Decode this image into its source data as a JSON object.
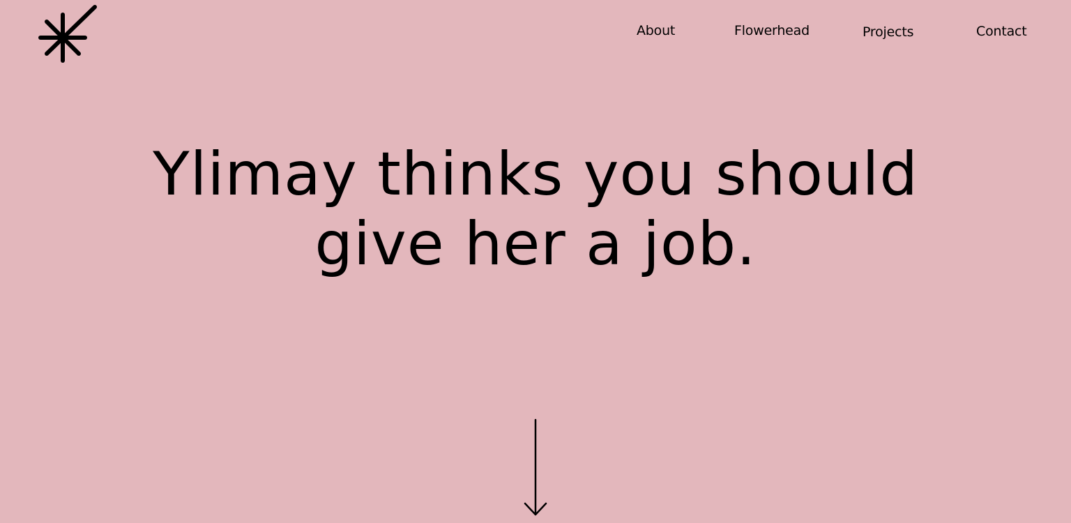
{
  "theme": {
    "background": "#E3B7BC",
    "foreground": "#000000"
  },
  "header": {
    "logo_icon": "asterisk-star-icon",
    "nav": [
      {
        "label": "About"
      },
      {
        "label": "Flowerhead"
      },
      {
        "label": "Projects"
      },
      {
        "label": "Contact"
      }
    ]
  },
  "hero": {
    "line1": "Ylimay thinks you should",
    "line2": "give her a job."
  },
  "scroll_indicator": {
    "icon": "arrow-down-icon"
  }
}
